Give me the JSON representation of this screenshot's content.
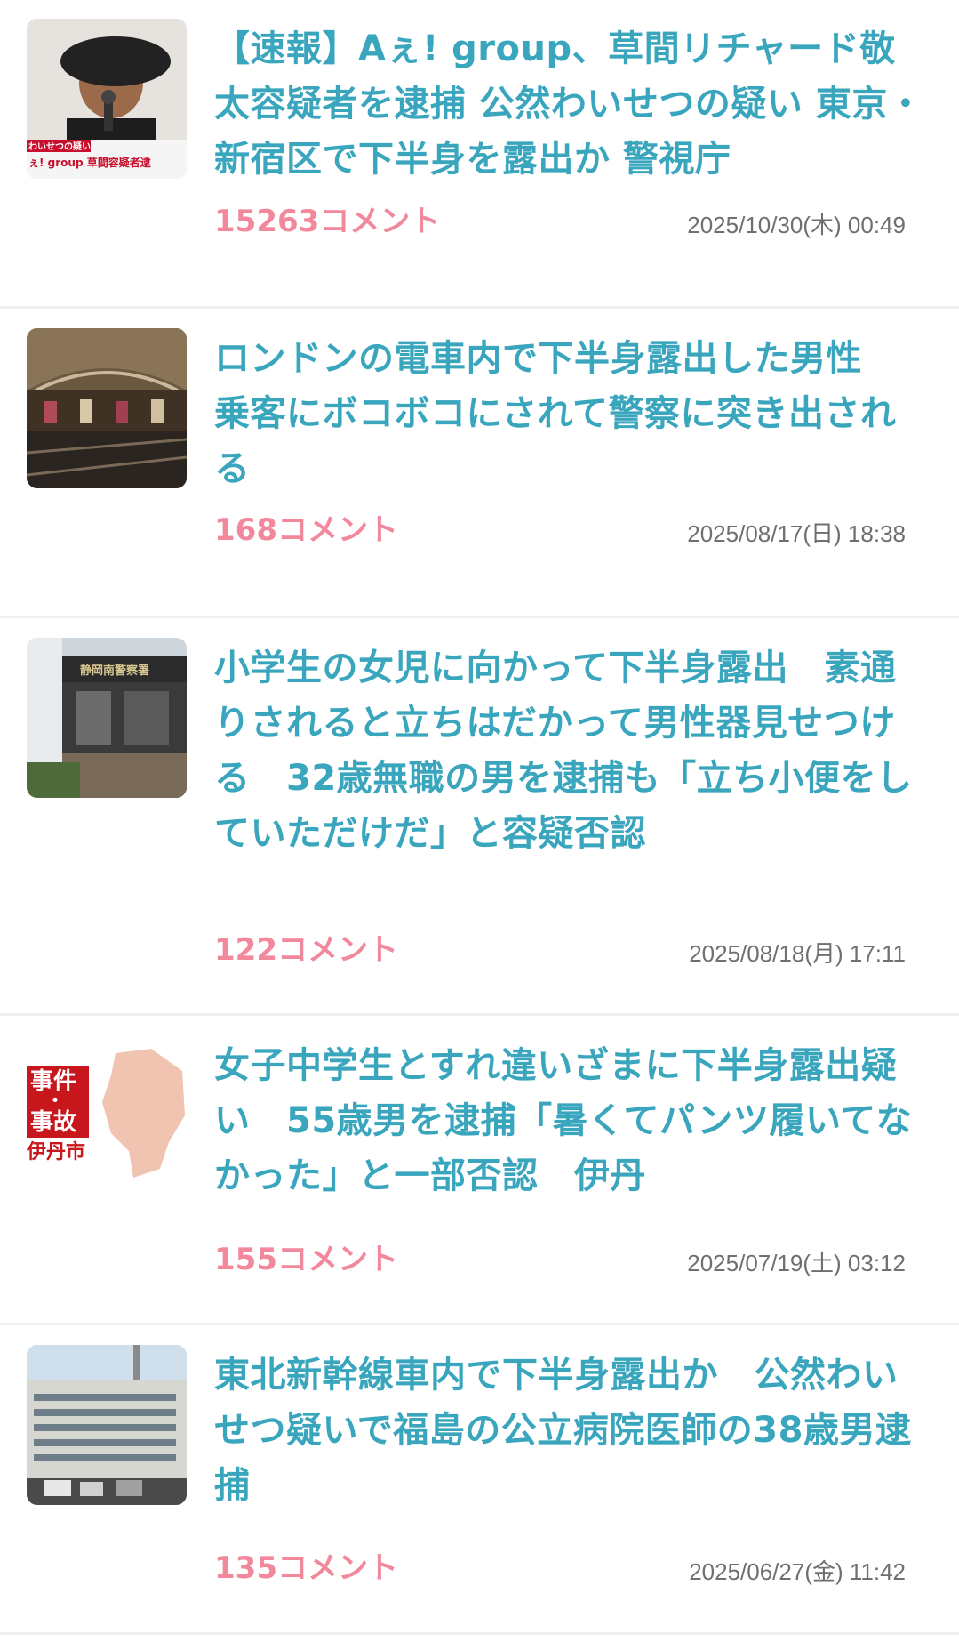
{
  "articles": [
    {
      "headline": "【速報】Aぇ! group、草間リチャード敬太容疑者を逮捕 公然わいせつの疑い 東京・新宿区で下半身を露出か 警視庁",
      "comments": "15263コメント",
      "date": "2025/10/30(木) 00:49",
      "thumb_caption_top": "わいせつの疑い",
      "thumb_caption_bottom": "ぇ! group 草間容疑者逮"
    },
    {
      "headline": "ロンドンの電車内で下半身露出した男性　乗客にボコボコにされて警察に突き出される",
      "comments": "168コメント",
      "date": "2025/08/17(日) 18:38"
    },
    {
      "headline": "小学生の女児に向かって下半身露出　素通りされると立ちはだかって男性器見せつける　32歳無職の男を逮捕も「立ち小便をしていただけだ」と容疑否認",
      "comments": "122コメント",
      "date": "2025/08/18(月) 17:11",
      "thumb_sign": "静岡南警察署"
    },
    {
      "headline": "女子中学生とすれ違いざまに下半身露出疑い　55歳男を逮捕「暑くてパンツ履いてなかった」と一部否認　伊丹",
      "comments": "155コメント",
      "date": "2025/07/19(土) 03:12",
      "thumb_badge_line1": "事件",
      "thumb_badge_dot": "・",
      "thumb_badge_line2": "事故",
      "thumb_city": "伊丹市"
    },
    {
      "headline": "東北新幹線車内で下半身露出か　公然わいせつ疑いで福島の公立病院医師の38歳男逮捕",
      "comments": "135コメント",
      "date": "2025/06/27(金) 11:42"
    }
  ],
  "colors": {
    "headline": "#3aa6be",
    "comments": "#f2889b",
    "date": "#6f6f6f",
    "divider": "#eef0f2"
  }
}
